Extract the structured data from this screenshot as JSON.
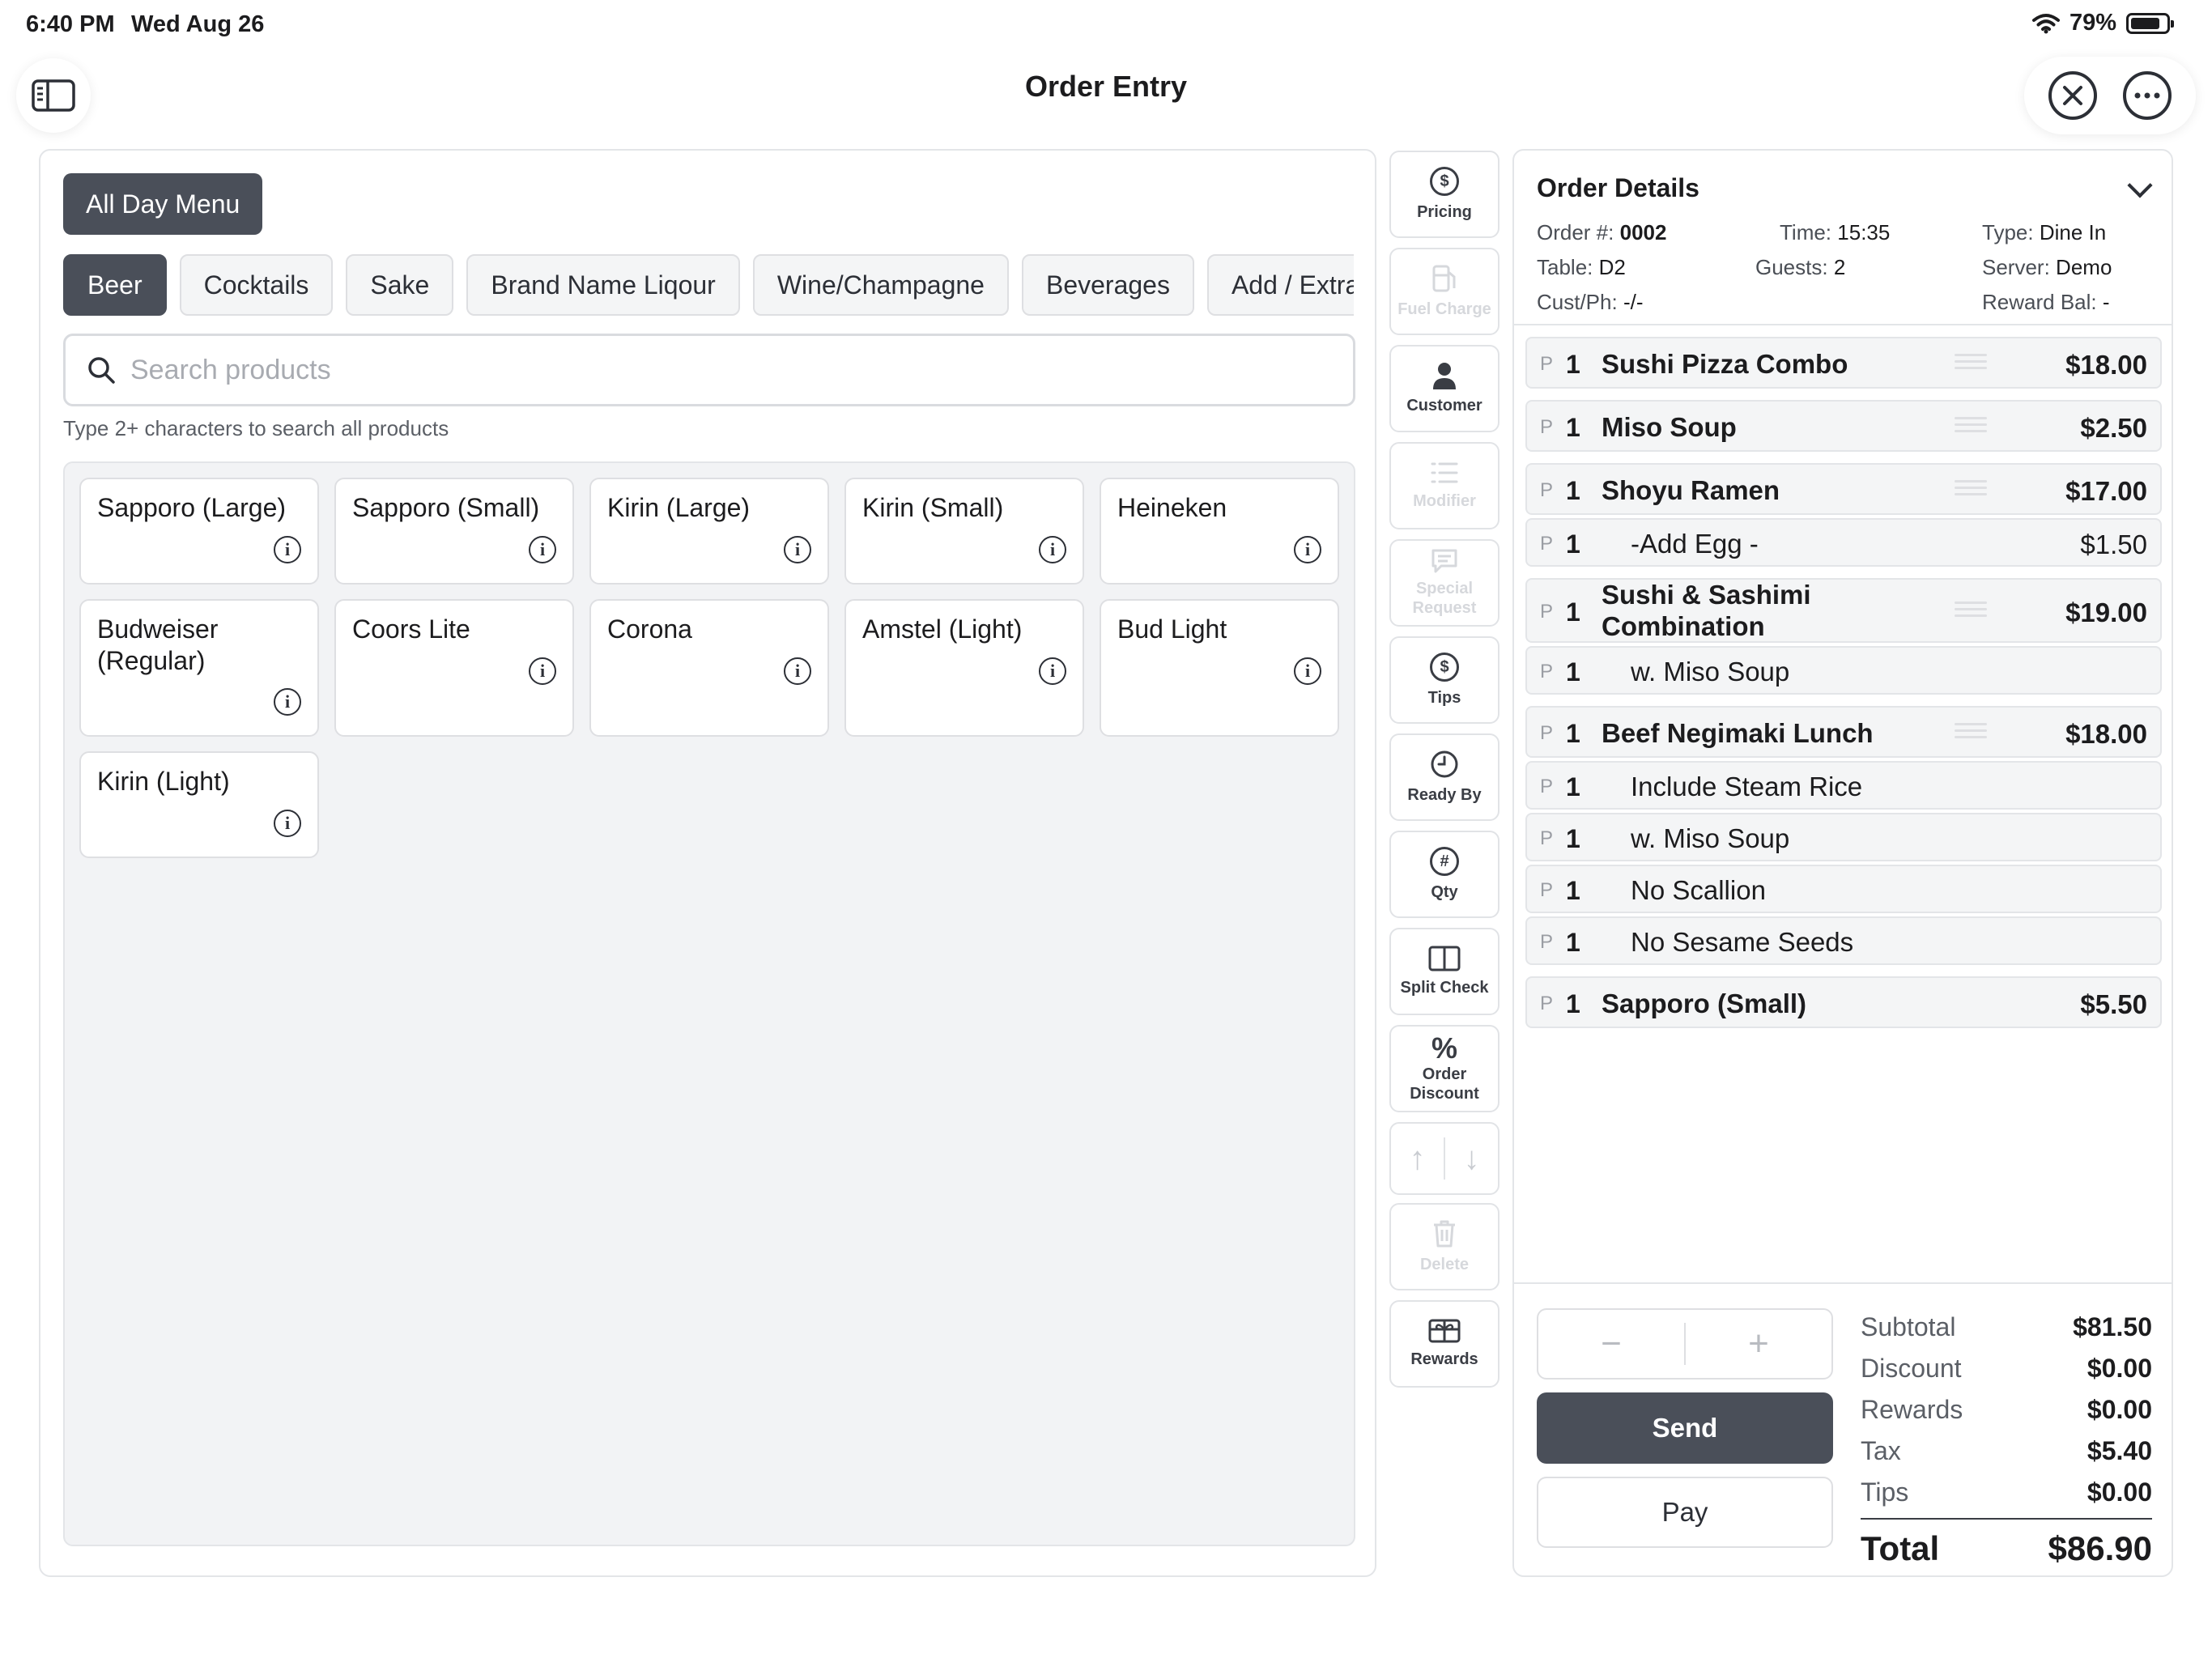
{
  "status_bar": {
    "time": "6:40 PM",
    "date": "Wed Aug 26",
    "battery": "79%"
  },
  "nav": {
    "title": "Order Entry"
  },
  "menu": {
    "active_menu": "All Day Menu",
    "categories": [
      "Beer",
      "Cocktails",
      "Sake",
      "Brand Name Liqour",
      "Wine/Champagne",
      "Beverages",
      "Add / Extra"
    ],
    "active_category": "Beer",
    "search_placeholder": "Search products",
    "search_hint": "Type 2+ characters to search all products",
    "products": [
      "Sapporo (Large)",
      "Sapporo (Small)",
      "Kirin (Large)",
      "Kirin (Small)",
      "Heineken",
      "Budweiser (Regular)",
      "Coors Lite",
      "Corona",
      "Amstel (Light)",
      "Bud Light",
      "Kirin (Light)"
    ]
  },
  "actions": {
    "pricing": "Pricing",
    "fuel_charge": "Fuel Charge",
    "customer": "Customer",
    "modifier": "Modifier",
    "special_request": "Special Request",
    "tips": "Tips",
    "ready_by": "Ready By",
    "qty": "Qty",
    "split_check": "Split Check",
    "order_discount": "Order Discount",
    "delete": "Delete",
    "rewards": "Rewards"
  },
  "order": {
    "title": "Order Details",
    "order_num_label": "Order #:",
    "order_num": "0002",
    "time_label": "Time:",
    "time": "15:35",
    "type_label": "Type:",
    "type": "Dine In",
    "table_label": "Table:",
    "table": "D2",
    "guests_label": "Guests:",
    "guests": "2",
    "server_label": "Server:",
    "server": "Demo",
    "cust_label": "Cust/Ph:",
    "cust": "-/-",
    "reward_label": "Reward Bal:",
    "reward": "-",
    "items": [
      {
        "p": "P",
        "qty": "1",
        "name": "Sushi Pizza Combo",
        "price": "$18.00"
      },
      {
        "p": "P",
        "qty": "1",
        "name": "Miso Soup",
        "price": "$2.50"
      },
      {
        "p": "P",
        "qty": "1",
        "name": "Shoyu Ramen",
        "price": "$17.00"
      },
      {
        "p": "P",
        "qty": "1",
        "name": "-Add Egg -",
        "price": "$1.50"
      },
      {
        "p": "P",
        "qty": "1",
        "name": "Sushi & Sashimi Combination Lunch",
        "price": "$19.00"
      },
      {
        "p": "P",
        "qty": "1",
        "name": "w. Miso Soup",
        "price": ""
      },
      {
        "p": "P",
        "qty": "1",
        "name": "Beef Negimaki Lunch",
        "price": "$18.00"
      },
      {
        "p": "P",
        "qty": "1",
        "name": "Include Steam Rice",
        "price": ""
      },
      {
        "p": "P",
        "qty": "1",
        "name": "w. Miso Soup",
        "price": ""
      },
      {
        "p": "P",
        "qty": "1",
        "name": "No Scallion",
        "price": ""
      },
      {
        "p": "P",
        "qty": "1",
        "name": "No Sesame Seeds",
        "price": ""
      },
      {
        "p": "P",
        "qty": "1",
        "name": "Sapporo (Small)",
        "price": "$5.50"
      }
    ],
    "send_label": "Send",
    "pay_label": "Pay",
    "totals": {
      "subtotal_label": "Subtotal",
      "subtotal": "$81.50",
      "discount_label": "Discount",
      "discount": "$0.00",
      "rewards_label": "Rewards",
      "rewards": "$0.00",
      "tax_label": "Tax",
      "tax": "$5.40",
      "tips_label": "Tips",
      "tips": "$0.00",
      "total_label": "Total",
      "total": "$86.90"
    }
  }
}
